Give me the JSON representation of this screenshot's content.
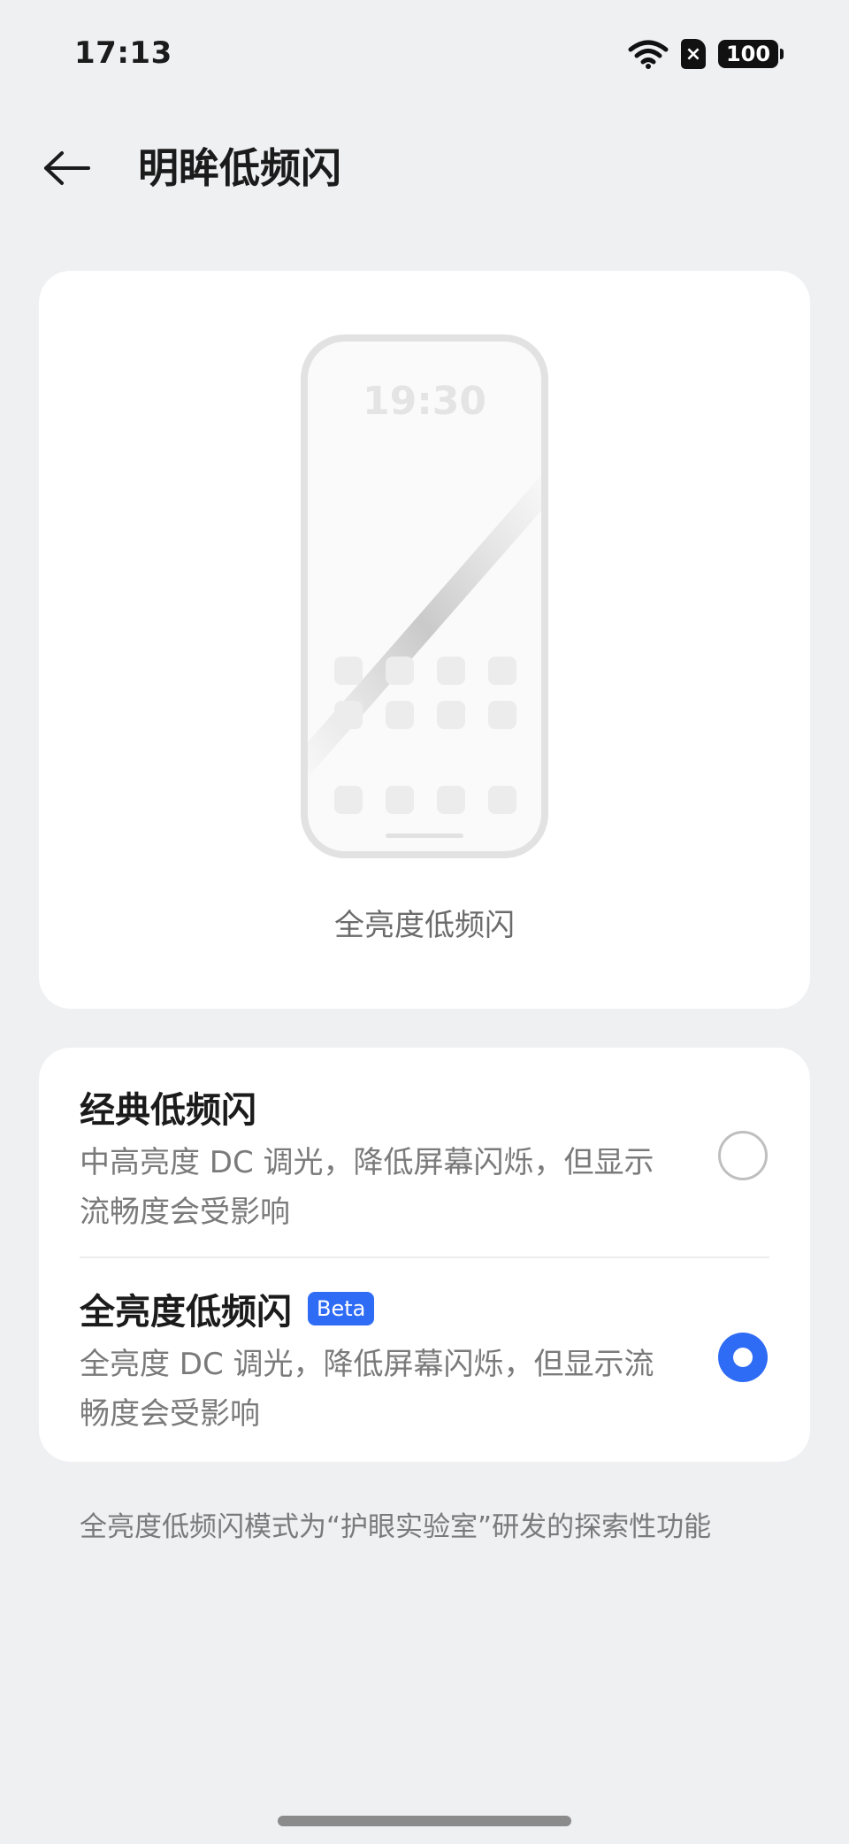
{
  "status_bar": {
    "time": "17:13",
    "sim_label": "×",
    "battery": "100"
  },
  "header": {
    "title": "明眸低频闪"
  },
  "preview": {
    "clock_text": "19:30",
    "caption": "全亮度低频闪"
  },
  "options": [
    {
      "title": "经典低频闪",
      "badge": "",
      "description": "中高亮度 DC 调光，降低屏幕闪烁，但显示流畅度会受影响",
      "selected": false
    },
    {
      "title": "全亮度低频闪",
      "badge": "Beta",
      "description": "全亮度 DC 调光，降低屏幕闪烁，但显示流畅度会受影响",
      "selected": true
    }
  ],
  "footnote": "全亮度低频闪模式为“护眼实验室”研发的探索性功能",
  "colors": {
    "accent": "#2f6cf5",
    "background": "#eff0f2"
  }
}
